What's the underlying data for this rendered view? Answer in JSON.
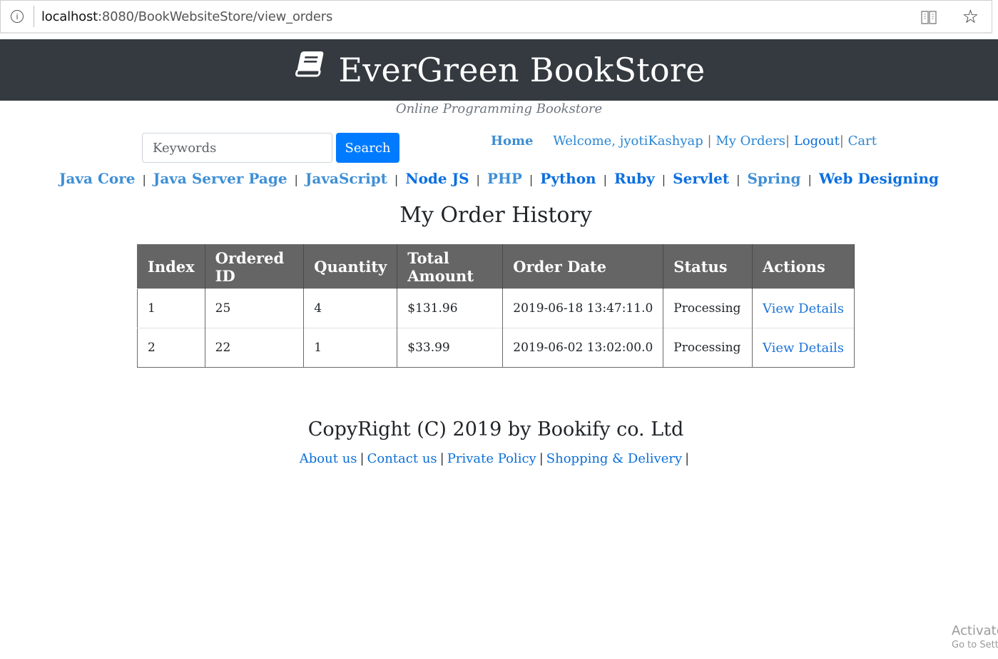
{
  "browser": {
    "url_host": "localhost",
    "url_rest": ":8080/BookWebsiteStore/view_orders",
    "icons": [
      "info-icon",
      "reader-view-icon",
      "favorite-star-icon"
    ]
  },
  "header": {
    "brand": "EverGreen BookStore",
    "tagline": "Online Programming Bookstore",
    "bg_color": "#343a40"
  },
  "search": {
    "placeholder": "Keywords",
    "button_label": "Search",
    "button_color": "#007bff"
  },
  "topnav": {
    "home": "Home",
    "welcome": "Welcome, jyotiKashyap",
    "my_orders": "My Orders",
    "logout": "Logout",
    "cart": "Cart",
    "sep": "|"
  },
  "categories": [
    {
      "label": "Java Core",
      "tone": "light"
    },
    {
      "label": "Java Server Page",
      "tone": "light"
    },
    {
      "label": "JavaScript",
      "tone": "light"
    },
    {
      "label": "Node JS",
      "tone": "dark"
    },
    {
      "label": "PHP",
      "tone": "light"
    },
    {
      "label": "Python",
      "tone": "dark"
    },
    {
      "label": "Ruby",
      "tone": "dark"
    },
    {
      "label": "Servlet",
      "tone": "dark"
    },
    {
      "label": "Spring",
      "tone": "light"
    },
    {
      "label": "Web Designing",
      "tone": "dark"
    }
  ],
  "orders": {
    "title": "My Order History",
    "columns": [
      "Index",
      "Ordered ID",
      "Quantity",
      "Total Amount",
      "Order Date",
      "Status",
      "Actions"
    ],
    "rows": [
      {
        "index": "1",
        "order_id": "25",
        "quantity": "4",
        "total": "$131.96",
        "date": "2019-06-18 13:47:11.0",
        "status": "Processing",
        "action": "View Details"
      },
      {
        "index": "2",
        "order_id": "22",
        "quantity": "1",
        "total": "$33.99",
        "date": "2019-06-02 13:02:00.0",
        "status": "Processing",
        "action": "View Details"
      }
    ],
    "header_bg": "#656565"
  },
  "footer": {
    "copyright": "CopyRight (C) 2019 by Bookify co. Ltd",
    "links": [
      "About us",
      "Contact us",
      "Private Policy",
      "Shopping & Delivery"
    ],
    "sep": "|"
  },
  "watermark": {
    "line1": "Activate",
    "line2": "Go to Settings"
  }
}
